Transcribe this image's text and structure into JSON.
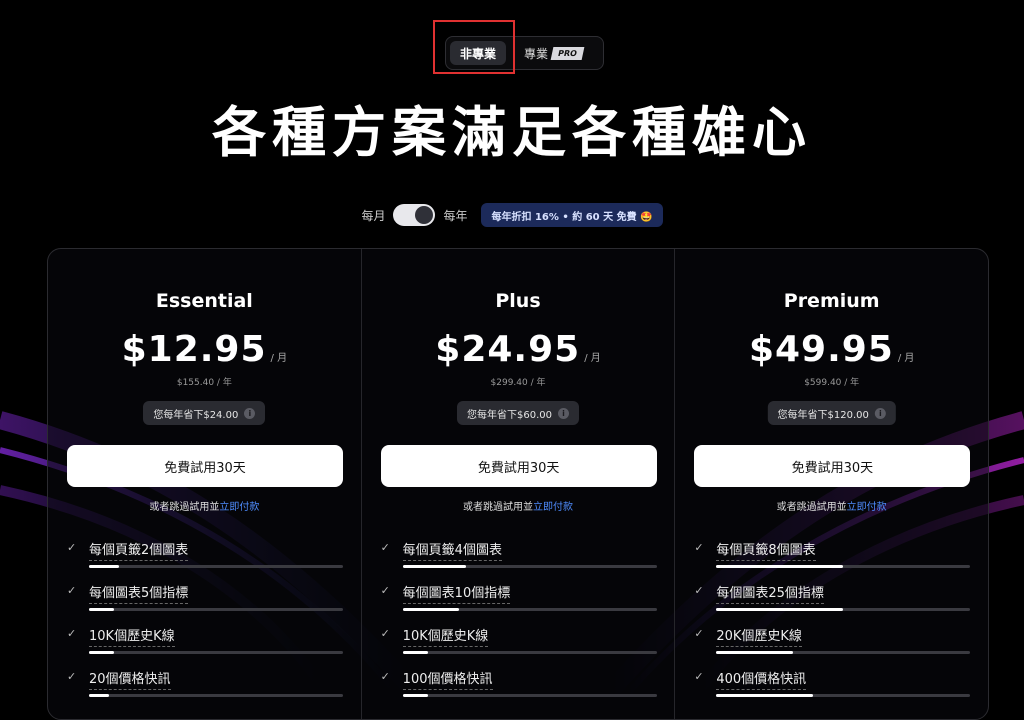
{
  "mode_switch": {
    "non_pro_label": "非專業",
    "pro_label": "專業",
    "pro_badge": "PRO"
  },
  "hero": {
    "title": "各種方案滿足各種雄心"
  },
  "billing": {
    "monthly_label": "每月",
    "yearly_label": "每年",
    "yearly_selected": true,
    "discount_note": "每年折扣 16% • 約 60 天 免費 🤩"
  },
  "colors": {
    "accent_link": "#4f8dff",
    "discount_bg": "#1c2a5a",
    "highlight": "#e03131"
  },
  "plans": [
    {
      "name": "Essential",
      "price": "$12.95",
      "period": "/ 月",
      "annual": "$155.40 / 年",
      "savings": "您每年省下$24.00",
      "cta": "免費試用30天",
      "skip_prefix": "或者跳過試用並",
      "skip_link": "立即付款",
      "features": [
        {
          "text": "每個頁籤2個圖表",
          "level": 0.12
        },
        {
          "text": "每個圖表5個指標",
          "level": 0.1
        },
        {
          "text": "10K個歷史K線",
          "level": 0.1
        },
        {
          "text": "20個價格快訊",
          "level": 0.08
        }
      ]
    },
    {
      "name": "Plus",
      "price": "$24.95",
      "period": "/ 月",
      "annual": "$299.40 / 年",
      "savings": "您每年省下$60.00",
      "cta": "免費試用30天",
      "skip_prefix": "或者跳過試用並",
      "skip_link": "立即付款",
      "features": [
        {
          "text": "每個頁籤4個圖表",
          "level": 0.25
        },
        {
          "text": "每個圖表10個指標",
          "level": 0.22
        },
        {
          "text": "10K個歷史K線",
          "level": 0.1
        },
        {
          "text": "100個價格快訊",
          "level": 0.1
        }
      ]
    },
    {
      "name": "Premium",
      "price": "$49.95",
      "period": "/ 月",
      "annual": "$599.40 / 年",
      "savings": "您每年省下$120.00",
      "cta": "免費試用30天",
      "skip_prefix": "或者跳過試用並",
      "skip_link": "立即付款",
      "features": [
        {
          "text": "每個頁籤8個圖表",
          "level": 0.5
        },
        {
          "text": "每個圖表25個指標",
          "level": 0.5
        },
        {
          "text": "20K個歷史K線",
          "level": 0.3
        },
        {
          "text": "400個價格快訊",
          "level": 0.38
        }
      ]
    }
  ]
}
